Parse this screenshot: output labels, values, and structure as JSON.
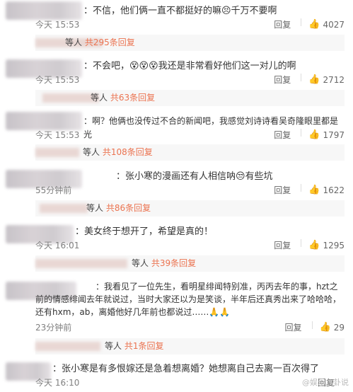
{
  "comments": [
    {
      "text": "：不信，他们俩一直不都挺好的嘛😣千万不要啊",
      "time": "今天 15:53",
      "reply": "回复",
      "likes": "4027",
      "thread_prefix": "等人",
      "thread_count": "共295条回复"
    },
    {
      "text": "：不会吧，😵😵😵我还是非常看好他们这一对儿的啊",
      "time": "今天 15:53",
      "reply": "回复",
      "likes": "2712",
      "thread_prefix": "等人",
      "thread_count": "共63条回复"
    },
    {
      "text": "：啊？他俩也没传过不合的新闻吧，我感觉刘诗诗看吴奇隆眼里都是光",
      "time": "今天 15:53",
      "reply": "回复",
      "likes": "1797",
      "thread_prefix": "等人",
      "thread_count": "共108条回复"
    },
    {
      "text": "：张小寒的漫画还有人相信呐😒有些坑",
      "time": "55分钟前",
      "reply": "回复",
      "likes": "1622",
      "thread_prefix": "等人",
      "thread_count": "共86条回复"
    },
    {
      "text": "：美女终于想开了，希望是真的！",
      "time": "今天 16:01",
      "reply": "回复",
      "likes": "1295",
      "thread_prefix": "等人",
      "thread_count": "共39条回复"
    },
    {
      "text": "：我看见了一位先生，看明星绯闻特别准，丙丙去年的事，hzt之前的情感绯闻去年就说过，当时大家还以为是笑谈，半年后还真秀出来了哈哈哈，还有hxm，ab，离婚他好几年前也都说过……🙏🙏",
      "time": "23分钟前",
      "reply": "回复",
      "likes": "29",
      "thread_prefix": "等人",
      "thread_count": "共1条回复"
    },
    {
      "text": "：张小寒是有多恨嫁还是急着想离婚？她想离自己去离一百次得了",
      "time": "今天 16:10",
      "reply": "回复",
      "likes": "",
      "thread_prefix": "",
      "thread_count": ""
    }
  ],
  "watermark": "@娱乐八卦说"
}
